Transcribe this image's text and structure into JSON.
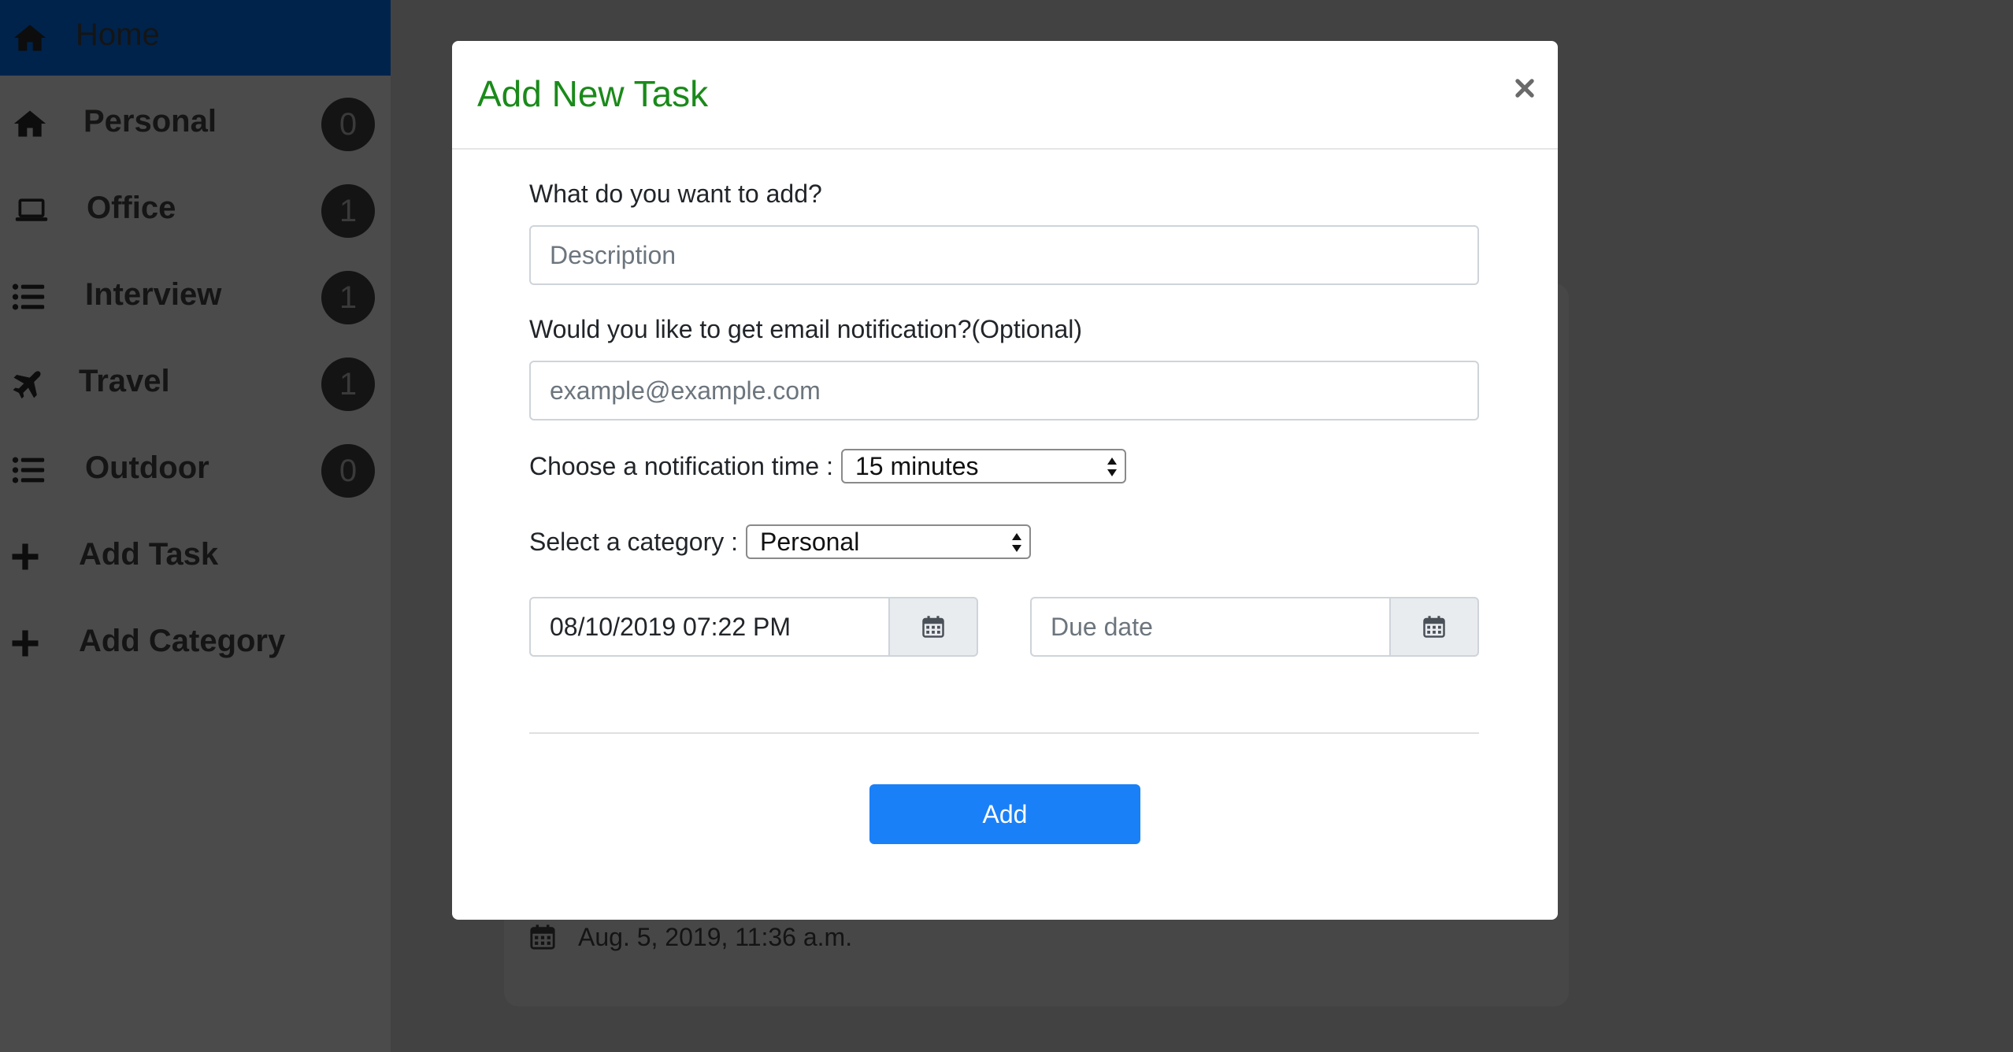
{
  "sidebar": {
    "home": {
      "label": "Home",
      "icon": "home-icon"
    },
    "categories": [
      {
        "label": "Personal",
        "count": "0",
        "icon": "home-icon"
      },
      {
        "label": "Office",
        "count": "1",
        "icon": "laptop-icon"
      },
      {
        "label": "Interview",
        "count": "1",
        "icon": "list-icon"
      },
      {
        "label": "Travel",
        "count": "1",
        "icon": "plane-icon"
      },
      {
        "label": "Outdoor",
        "count": "0",
        "icon": "list-icon"
      }
    ],
    "actions": [
      {
        "label": "Add Task",
        "icon": "plus-icon"
      },
      {
        "label": "Add Category",
        "icon": "plus-icon"
      }
    ]
  },
  "background": {
    "task_date": "Aug. 5, 2019, 11:36 a.m."
  },
  "modal": {
    "title": "Add New Task",
    "close_glyph": "×",
    "description_label": "What do you want to add?",
    "description_placeholder": "Description",
    "email_label": "Would you like to get email notification?(Optional)",
    "email_placeholder": "example@example.com",
    "notification_label": "Choose a notification time :",
    "notification_value": "15 minutes",
    "category_label": "Select a category :",
    "category_value": "Personal",
    "start_date_value": "08/10/2019 07:22 PM",
    "due_date_placeholder": "Due date",
    "add_label": "Add"
  },
  "colors": {
    "title_green": "#1a8a1a",
    "button_blue": "#1a80f7",
    "home_active": "#00234c",
    "backdrop": "#424243"
  }
}
